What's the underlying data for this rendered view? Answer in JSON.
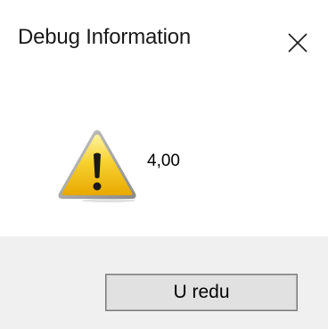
{
  "window": {
    "title": "Debug Information",
    "close_icon": "close-icon"
  },
  "message": {
    "icon": "warning-icon",
    "text": "4,00"
  },
  "footer": {
    "ok_label": "U redu"
  },
  "colors": {
    "footer_background": "#f0f0f0",
    "warning_yellow": "#f5c518",
    "button_face": "#e1e1e1"
  }
}
